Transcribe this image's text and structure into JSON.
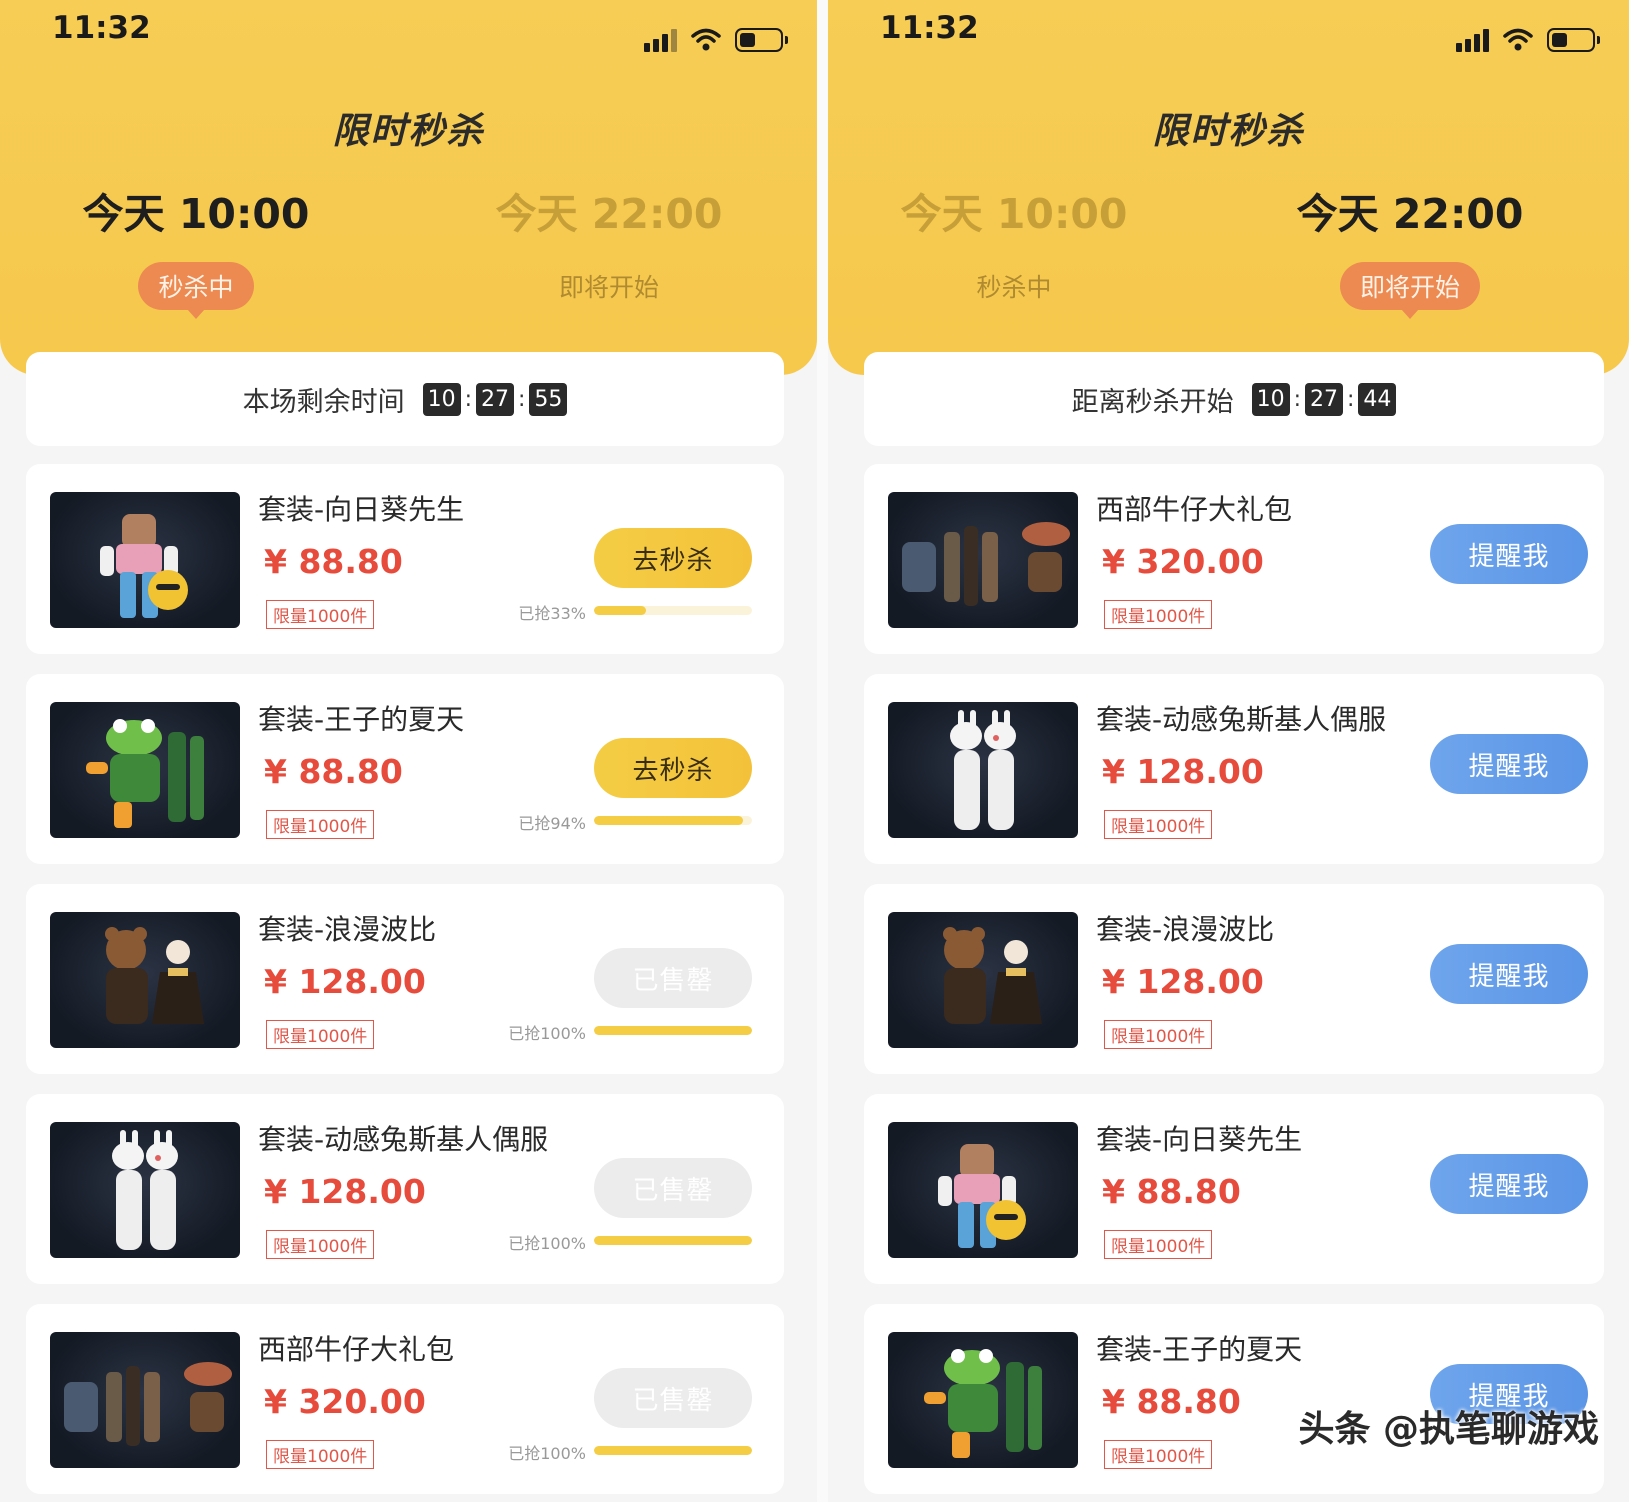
{
  "left": {
    "status": {
      "time": "11:32"
    },
    "title": "限时秒杀",
    "sessions": [
      {
        "time": "今天 10:00",
        "state": "秒杀中"
      },
      {
        "time": "今天 22:00",
        "state": "即将开始"
      }
    ],
    "timer": {
      "label": "本场剩余时间",
      "h": "10",
      "m": "27",
      "s": "55"
    },
    "items": [
      {
        "name": "套装-向日葵先生",
        "price": "¥ 88.80",
        "limit": "限量1000件",
        "button": "去秒杀",
        "progress_label": "已抢33%",
        "progress": 0.33
      },
      {
        "name": "套装-王子的夏天",
        "price": "¥ 88.80",
        "limit": "限量1000件",
        "button": "去秒杀",
        "progress_label": "已抢94%",
        "progress": 0.94
      },
      {
        "name": "套装-浪漫波比",
        "price": "¥ 128.00",
        "limit": "限量1000件",
        "button": "已售罄",
        "progress_label": "已抢100%",
        "progress": 1.0
      },
      {
        "name": "套装-动感兔斯基人偶服",
        "price": "¥ 128.00",
        "limit": "限量1000件",
        "button": "已售罄",
        "progress_label": "已抢100%",
        "progress": 1.0
      },
      {
        "name": "西部牛仔大礼包",
        "price": "¥ 320.00",
        "limit": "限量1000件",
        "button": "已售罄",
        "progress_label": "已抢100%",
        "progress": 1.0
      }
    ]
  },
  "right": {
    "status": {
      "time": "11:32"
    },
    "title": "限时秒杀",
    "sessions": [
      {
        "time": "今天 10:00",
        "state": "秒杀中"
      },
      {
        "time": "今天 22:00",
        "state": "即将开始"
      }
    ],
    "timer": {
      "label": "距离秒杀开始",
      "h": "10",
      "m": "27",
      "s": "44"
    },
    "items": [
      {
        "name": "西部牛仔大礼包",
        "price": "¥ 320.00",
        "limit": "限量1000件",
        "button": "提醒我"
      },
      {
        "name": "套装-动感兔斯基人偶服",
        "price": "¥ 128.00",
        "limit": "限量1000件",
        "button": "提醒我"
      },
      {
        "name": "套装-浪漫波比",
        "price": "¥ 128.00",
        "limit": "限量1000件",
        "button": "提醒我"
      },
      {
        "name": "套装-向日葵先生",
        "price": "¥ 88.80",
        "limit": "限量1000件",
        "button": "提醒我"
      },
      {
        "name": "套装-王子的夏天",
        "price": "¥ 88.80",
        "limit": "限量1000件",
        "button": "提醒我"
      }
    ]
  },
  "watermark": "头条 @执笔聊游戏",
  "colors": {
    "header": "#f6c84c",
    "price": "#e64b3c",
    "grab_button": "#f3c23a",
    "remind_button": "#5b95e6",
    "soldout_button": "#ececec",
    "active_badge": "#ec8a52"
  }
}
